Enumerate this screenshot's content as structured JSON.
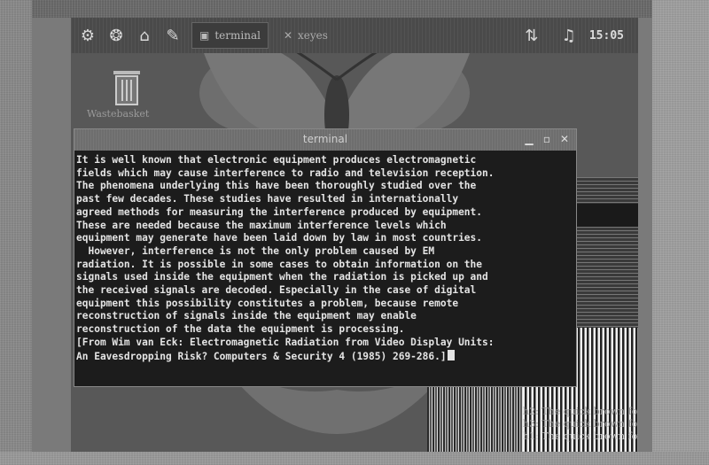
{
  "taskbar": {
    "tasks": [
      {
        "label": "terminal",
        "active": true
      },
      {
        "label": "xeyes",
        "active": false
      }
    ],
    "clock": "15:05"
  },
  "desktop": {
    "trash_label": "Wastebasket"
  },
  "terminal": {
    "title": "terminal",
    "lines": [
      "It is well known that electronic equipment produces electromagnetic",
      "fields which may cause interference to radio and television reception.",
      "The phenomena underlying this have been thoroughly studied over the",
      "past few decades. These studies have resulted in internationally",
      "agreed methods for measuring the interference produced by equipment.",
      "These are needed because the maximum interference levels which",
      "equipment may generate have been laid down by law in most countries.",
      "  However, interference is not the only problem caused by EM",
      "radiation. It is possible in some cases to obtain information on the",
      "signals used inside the equipment when the radiation is picked up and",
      "the received signals are decoded. Especially in the case of digital",
      "equipment this possibility constitutes a problem, because remote",
      "reconstruction of signals inside the equipment may enable",
      "reconstruction of the data the equipment is processing.",
      "[From Wim van Eck: Electromagnetic Radiation from Video Display Units:",
      "An Eavesdropping Risk? Computers & Security 4 (1985) 269-286.]"
    ]
  },
  "background": {
    "text_lines": [
      "h2: The quick brown fox",
      "h3: The quick brown fox",
      "h1: The quick brown fox"
    ]
  }
}
